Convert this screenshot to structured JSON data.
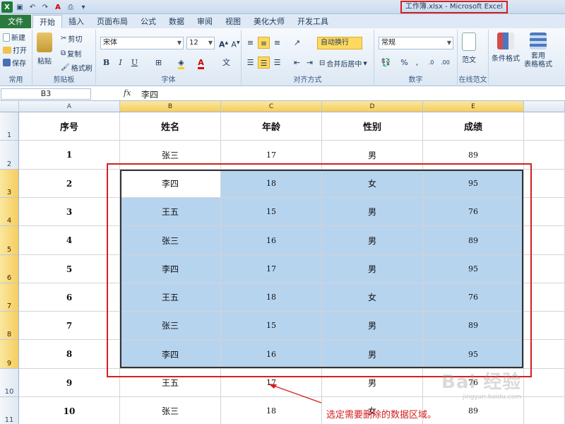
{
  "window": {
    "title": "工作簿.xlsx - Microsoft Excel"
  },
  "tabs": [
    "文件",
    "开始",
    "插入",
    "页面布局",
    "公式",
    "数据",
    "审阅",
    "视图",
    "美化大师",
    "开发工具"
  ],
  "ribbon": {
    "clipboard": {
      "label": "剪贴板",
      "new": "新建",
      "open": "打开",
      "save": "保存",
      "common": "常用",
      "paste": "粘贴",
      "cut": "剪切",
      "copy": "复制",
      "format_painter": "格式刷"
    },
    "font": {
      "label": "字体",
      "name": "宋体",
      "size": "12",
      "bold": "B",
      "italic": "I",
      "underline": "U"
    },
    "alignment": {
      "label": "对齐方式",
      "wrap": "自动换行",
      "merge": "合并后居中"
    },
    "number": {
      "label": "数字",
      "format": "常规"
    },
    "template": {
      "label": "在线范文",
      "btn": "范文"
    },
    "styles": {
      "cond_format": "条件格式",
      "table_format": "套用\n表格格式"
    }
  },
  "formula_bar": {
    "name_box": "B3",
    "fx": "fx",
    "value": "李四"
  },
  "columns": [
    "A",
    "B",
    "C",
    "D",
    "E"
  ],
  "rows": [
    "1",
    "2",
    "3",
    "4",
    "5",
    "6",
    "7",
    "8",
    "9",
    "10",
    "11"
  ],
  "table": {
    "headers": [
      "序号",
      "姓名",
      "年龄",
      "性别",
      "成绩"
    ],
    "data": [
      [
        "1",
        "张三",
        "17",
        "男",
        "89"
      ],
      [
        "2",
        "李四",
        "18",
        "女",
        "95"
      ],
      [
        "3",
        "王五",
        "15",
        "男",
        "76"
      ],
      [
        "4",
        "张三",
        "16",
        "男",
        "89"
      ],
      [
        "5",
        "李四",
        "17",
        "男",
        "95"
      ],
      [
        "6",
        "王五",
        "18",
        "女",
        "76"
      ],
      [
        "7",
        "张三",
        "15",
        "男",
        "89"
      ],
      [
        "8",
        "李四",
        "16",
        "男",
        "95"
      ],
      [
        "9",
        "王五",
        "17",
        "男",
        "76"
      ],
      [
        "10",
        "张三",
        "18",
        "女",
        "89"
      ]
    ]
  },
  "annotation": "选定需要删除的数据区域。",
  "watermark": "Bai 经验",
  "watermark_url": "jingyan.baidu.com"
}
